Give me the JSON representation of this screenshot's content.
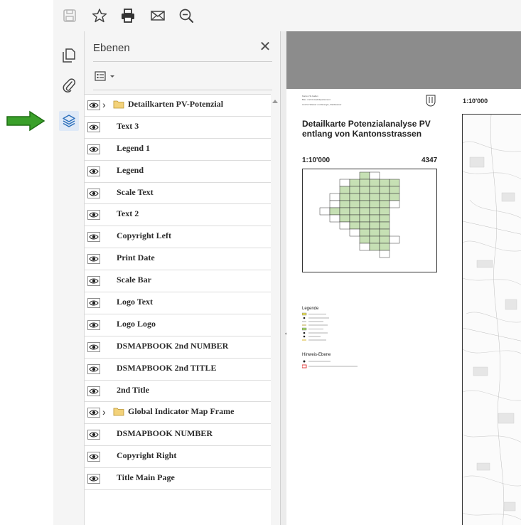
{
  "toolbar": {
    "buttons": [
      {
        "icon": "save-icon"
      },
      {
        "icon": "star-icon"
      },
      {
        "icon": "print-icon"
      },
      {
        "icon": "mail-icon"
      },
      {
        "icon": "zoom-out-icon"
      }
    ]
  },
  "rail": {
    "items": [
      {
        "icon": "pages-icon"
      },
      {
        "icon": "attachment-icon"
      },
      {
        "icon": "layers-icon",
        "active": true
      }
    ]
  },
  "panel": {
    "title": "Ebenen",
    "close_glyph": "✕",
    "options_icon": "list-options-icon",
    "layers": [
      {
        "label": "Detailkarten PV-Potenzial",
        "group": true
      },
      {
        "label": "Text 3"
      },
      {
        "label": "Legend 1"
      },
      {
        "label": "Legend"
      },
      {
        "label": "Scale Text"
      },
      {
        "label": "Text 2"
      },
      {
        "label": "Copyright Left"
      },
      {
        "label": "Print Date"
      },
      {
        "label": "Scale Bar"
      },
      {
        "label": "Logo Text"
      },
      {
        "label": "Logo Logo"
      },
      {
        "label": "DSMAPBOOK 2nd NUMBER"
      },
      {
        "label": "DSMAPBOOK 2nd TITLE"
      },
      {
        "label": "2nd Title"
      },
      {
        "label": "Global Indicator Map Frame",
        "group": true
      },
      {
        "label": "DSMAPBOOK NUMBER"
      },
      {
        "label": "Copyright Right"
      },
      {
        "label": "Title Main Page"
      }
    ]
  },
  "document": {
    "header_small": [
      "Kanton St.Gallen",
      "Bau- und Umweltdepartement",
      "Amt für Wasser und Energie, Fließwasser"
    ],
    "title_line1": "Detailkarte Potenzialanalyse PV",
    "title_line2": "entlang von Kantonsstrassen",
    "scale": "1:10'000",
    "map_number": "4347",
    "scale_right": "1:10'000",
    "legend_title": "Legende",
    "hinweis_title": "Hinweis-Ebene"
  },
  "colors": {
    "accent": "#2a6ebb",
    "arrow_green": "#3aa02a",
    "overview_green": "#c6e0b4",
    "highlight_red": "#e03030"
  }
}
